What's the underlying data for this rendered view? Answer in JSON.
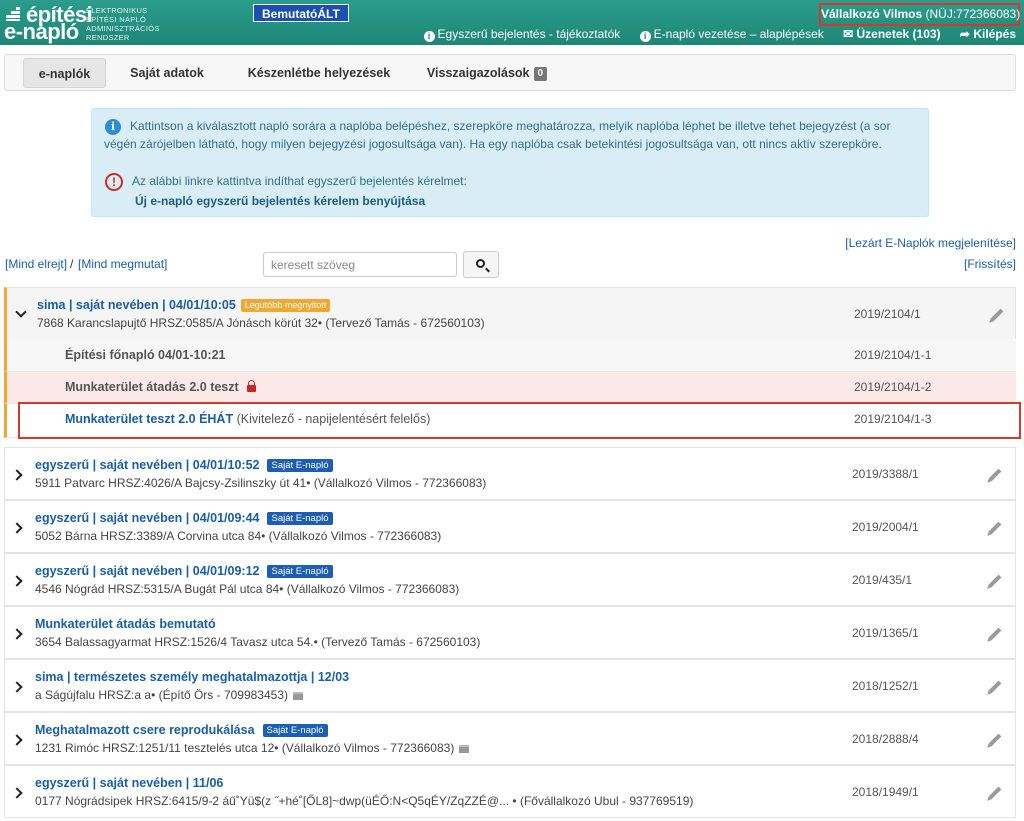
{
  "header": {
    "logo_line1": "építési",
    "logo_line2": "e-napló",
    "logo_sub": [
      "ELEKTRONIKUS",
      "ÉPÍTÉSI NAPLÓ",
      "ADMINISZTRÁCIÓS",
      "RENDSZER"
    ],
    "demo_badge": "BemutatóÁLT",
    "user_name": "Vállalkozó Vilmos",
    "user_id": "(NÜJ:772366083)",
    "links": {
      "simple": "Egyszerű bejelentés - tájékoztatók",
      "basics": "E-napló vezetése – alaplépések",
      "messages": "Üzenetek (103)",
      "logout": "Kilépés"
    }
  },
  "tabs": [
    {
      "label": "e-naplók"
    },
    {
      "label": "Saját adatok"
    },
    {
      "label": "Készenlétbe helyezések"
    },
    {
      "label": "Visszaigazolások",
      "count": "0"
    }
  ],
  "info": {
    "text": "Kattintson a kiválasztott napló sorára a naplóba belépéshez, szerepköre meghatározza, melyik naplóba léphet be illetve tehet bejegyzést (a sor végén zárójelben látható, hogy milyen bejegyzési jogosultsága van). Ha egy naplóba csak betekintési jogosultsága van, ott nincs aktív szerepköre.",
    "warn_text": "Az alábbi linkre kattintva indíthat egyszerű bejelentés kérelmet:",
    "link": "Új e-napló egyszerű bejelentés kérelem benyújtása"
  },
  "toolbar": {
    "hide_all": "[Mind elrejt]",
    "separator": "/",
    "show_all": "[Mind megmutat]",
    "search_placeholder": "keresett szöveg",
    "closed_logs": "[Lezárt E-Naplók megjelenítése]",
    "refresh": "[Frissítés]"
  },
  "logs": [
    {
      "title": "sima | saját nevében | 04/01/10:05",
      "tag": "Legutóbb megnyitott",
      "sub": "7868 Karancslapujtő HRSZ:0585/A Jónásch körút 32• (Tervező Tamás - 672560103)",
      "num": "2019/2104/1"
    },
    {
      "title": "egyszerű | saját nevében | 04/01/10:52",
      "tag": "Saját E-napló",
      "sub": "5911 Patvarc HRSZ:4026/A Bajcsy-Zsilinszky út 41• (Vállalkozó Vilmos - 772366083)",
      "num": "2019/3388/1"
    },
    {
      "title": "egyszerű | saját nevében | 04/01/09:44",
      "tag": "Saját E-napló",
      "sub": "5052 Bárna HRSZ:3389/A Corvina utca 84• (Vállalkozó Vilmos - 772366083)",
      "num": "2019/2004/1"
    },
    {
      "title": "egyszerű | saját nevében | 04/01/09:12",
      "tag": "Saját E-napló",
      "sub": "4546 Nógrád HRSZ:5315/A Bugát Pál utca 84• (Vállalkozó Vilmos - 772366083)",
      "num": "2019/435/1"
    },
    {
      "title": "Munkaterület átadás bemutató",
      "tag": "",
      "sub": "3654 Balassagyarmat HRSZ:1526/4 Tavasz utca 54.• (Tervező Tamás - 672560103)",
      "num": "2019/1365/1"
    },
    {
      "title": "sima | természetes személy meghatalmazottja | 12/03",
      "tag": "",
      "sub": "a Ságújfalu HRSZ:a a• (Építő Örs - 709983453)",
      "num": "2018/1252/1"
    },
    {
      "title": "Meghatalmazott csere reprodukálása",
      "tag": "Saját E-napló",
      "sub": "1231 Rimóc HRSZ:1251/11 tesztelés utca 12• (Vállalkozó Vilmos - 772366083)",
      "num": "2018/2888/4"
    },
    {
      "title": "egyszerű | saját nevében | 11/06",
      "tag": "",
      "sub": "0177 Nógrádsipek HRSZ:6415/9-2 áű˚Yü$(z ˝+hé˚[ŐL8]~dwp(üÉŐ:N<Q5qÉY/ZqZZÉ@... • (Fővállalkozó Ubul - 937769519)",
      "num": "2018/1949/1"
    }
  ],
  "sublogs": [
    {
      "title": "Építési főnapló 04/01-10:21",
      "role": "",
      "num": "2019/2104/1-1"
    },
    {
      "title": "Munkaterület átadás 2.0 teszt",
      "role": "",
      "num": "2019/2104/1-2"
    },
    {
      "title": "Munkaterület teszt 2.0 ÉHÁT",
      "role": "(Kivitelező - napijelentésért felelős)",
      "num": "2019/2104/1-3"
    }
  ],
  "colors": {
    "header": "#1f8676",
    "link": "#1a5ea6",
    "highlight": "#d33a2c"
  }
}
